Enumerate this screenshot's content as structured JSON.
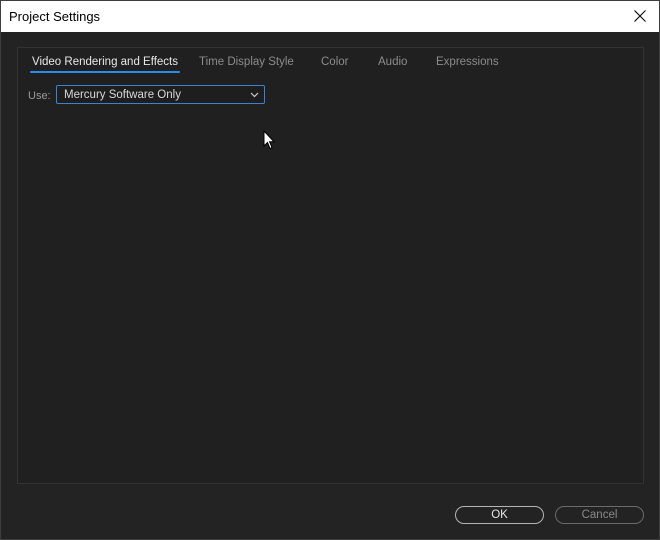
{
  "window": {
    "title": "Project Settings",
    "close_icon": "close-icon"
  },
  "tabs": [
    {
      "label": "Video Rendering and Effects",
      "active": true
    },
    {
      "label": "Time Display Style",
      "active": false
    },
    {
      "label": "Color",
      "active": false
    },
    {
      "label": "Audio",
      "active": false
    },
    {
      "label": "Expressions",
      "active": false
    }
  ],
  "renderer": {
    "label": "Use:",
    "selected": "Mercury Software Only"
  },
  "footer": {
    "ok_label": "OK",
    "cancel_label": "Cancel"
  },
  "colors": {
    "accent": "#2d8ceb",
    "background": "#232323"
  }
}
